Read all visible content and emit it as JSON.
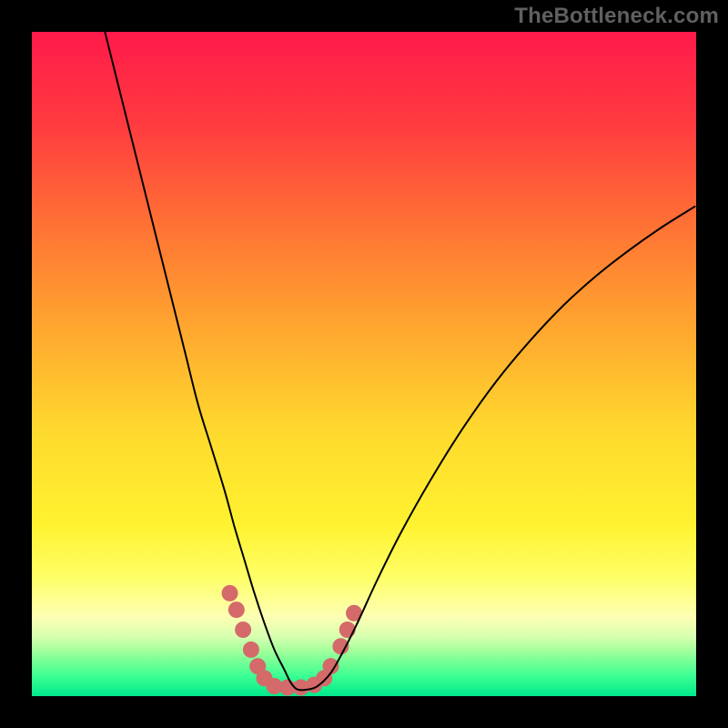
{
  "watermark": "TheBottleneck.com",
  "chart_data": {
    "type": "line",
    "title": "",
    "xlabel": "",
    "ylabel": "",
    "xlim": [
      0,
      100
    ],
    "ylim": [
      0,
      100
    ],
    "gradient_stops": [
      {
        "offset": 0.0,
        "color": "#ff1a4b"
      },
      {
        "offset": 0.14,
        "color": "#ff3b3f"
      },
      {
        "offset": 0.3,
        "color": "#ff7534"
      },
      {
        "offset": 0.45,
        "color": "#ffa82f"
      },
      {
        "offset": 0.6,
        "color": "#ffd92e"
      },
      {
        "offset": 0.74,
        "color": "#fff22f"
      },
      {
        "offset": 0.82,
        "color": "#ffff66"
      },
      {
        "offset": 0.88,
        "color": "#fdffb3"
      },
      {
        "offset": 0.91,
        "color": "#d8ffb0"
      },
      {
        "offset": 0.93,
        "color": "#a7ff9d"
      },
      {
        "offset": 0.95,
        "color": "#70ff95"
      },
      {
        "offset": 0.97,
        "color": "#3bff93"
      },
      {
        "offset": 1.0,
        "color": "#00e88b"
      }
    ],
    "series": [
      {
        "name": "bottleneck-curve",
        "stroke": "#000000",
        "stroke_width": 2,
        "x": [
          11.0,
          13.0,
          15.5,
          18.0,
          20.5,
          23.0,
          25.0,
          27.0,
          29.0,
          30.5,
          32.0,
          33.5,
          35.0,
          36.5,
          38.0,
          39.0,
          40.0,
          41.5,
          43.0,
          45.0,
          47.0,
          49.0,
          52.0,
          55.5,
          60.0,
          65.0,
          70.0,
          75.0,
          80.0,
          85.0,
          90.0,
          95.0,
          99.8
        ],
        "y": [
          100.0,
          92.0,
          82.0,
          72.0,
          62.0,
          52.0,
          44.0,
          37.5,
          31.0,
          25.5,
          20.5,
          15.5,
          11.0,
          7.0,
          4.0,
          2.0,
          1.0,
          1.0,
          1.5,
          3.5,
          7.0,
          11.0,
          17.5,
          24.5,
          32.5,
          40.5,
          47.5,
          53.5,
          58.8,
          63.3,
          67.2,
          70.7,
          73.7
        ]
      }
    ],
    "dot_cluster": {
      "name": "cluster-dots",
      "color": "#d46a6a",
      "radius": 9,
      "points": [
        {
          "x": 29.8,
          "y": 15.5
        },
        {
          "x": 30.8,
          "y": 13.0
        },
        {
          "x": 31.8,
          "y": 10.0
        },
        {
          "x": 33.0,
          "y": 7.0
        },
        {
          "x": 34.0,
          "y": 4.5
        },
        {
          "x": 35.0,
          "y": 2.7
        },
        {
          "x": 36.5,
          "y": 1.5
        },
        {
          "x": 38.5,
          "y": 1.3
        },
        {
          "x": 40.5,
          "y": 1.3
        },
        {
          "x": 42.5,
          "y": 1.7
        },
        {
          "x": 44.0,
          "y": 2.7
        },
        {
          "x": 45.0,
          "y": 4.5
        },
        {
          "x": 46.5,
          "y": 7.5
        },
        {
          "x": 47.5,
          "y": 10.0
        },
        {
          "x": 48.5,
          "y": 12.5
        }
      ]
    }
  }
}
